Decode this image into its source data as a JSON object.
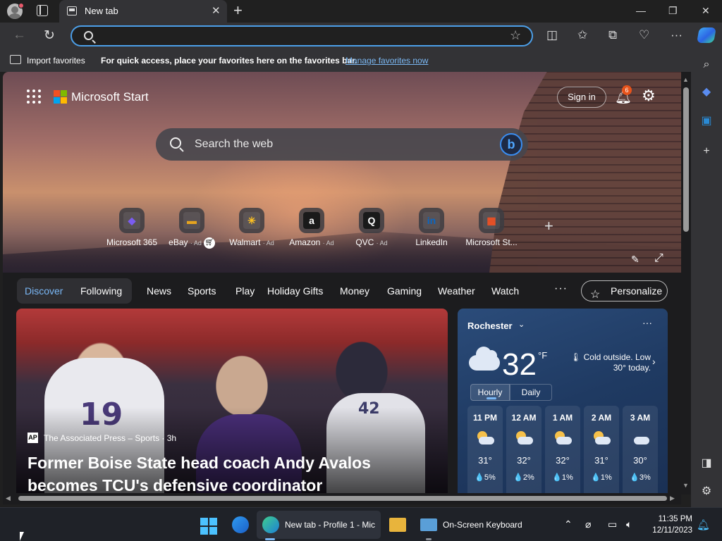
{
  "browser": {
    "tab_title": "New tab",
    "tab_close": "✕",
    "new_tab": "+",
    "win_minimize": "—",
    "win_restore": "❐",
    "win_close": "✕",
    "address_value": "",
    "address_placeholder": "",
    "favorites_bar": {
      "import_label": "Import favorites",
      "hint": "For quick access, place your favorites here on the favorites bar.",
      "manage_link": "Manage favorites now"
    }
  },
  "page": {
    "brand": "Microsoft Start",
    "sign_in": "Sign in",
    "notifications_count": "6",
    "search_placeholder": "Search the web",
    "bing_glyph": "b",
    "quick_links": [
      {
        "label": "Microsoft 365",
        "ad": "",
        "glyph": "◆",
        "color": "#7a5cf0"
      },
      {
        "label": "eBay",
        "ad": "· Ad",
        "glyph": "▬",
        "color": "#e5a41f"
      },
      {
        "label": "Walmart",
        "ad": "· Ad",
        "glyph": "✳",
        "color": "#ffc220"
      },
      {
        "label": "Amazon",
        "ad": "· Ad",
        "glyph": "a",
        "color": "#ffffff"
      },
      {
        "label": "QVC",
        "ad": "· Ad",
        "glyph": "Q",
        "color": "#ffffff"
      },
      {
        "label": "LinkedIn",
        "ad": "",
        "glyph": "in",
        "color": "#0a66c2"
      },
      {
        "label": "Microsoft St...",
        "ad": "",
        "glyph": "▦",
        "color": "#f25022"
      }
    ],
    "nav": {
      "tabs": [
        "Discover",
        "Following",
        "News",
        "Sports",
        "Play",
        "Holiday Gifts",
        "Money",
        "Gaming",
        "Weather",
        "Watch"
      ],
      "more": "···",
      "personalize": "Personalize"
    },
    "article": {
      "source_logo": "AP",
      "source": "The Associated Press – Sports · 3h",
      "title": "Former Boise State head coach Andy Avalos becomes TCU's defensive coordinator",
      "jersey_a": "19",
      "jersey_b": "42"
    },
    "weather": {
      "city": "Rochester",
      "chevron": "⌄",
      "more": "···",
      "temp": "32",
      "unit": "°F",
      "condition": "🌡 Cold outside. Low 30° today.",
      "arrow": "›",
      "tabs": [
        "Hourly",
        "Daily"
      ],
      "hours": [
        {
          "time": "11 PM",
          "temp": "31°",
          "precip": "💧5%",
          "sun": true
        },
        {
          "time": "12 AM",
          "temp": "32°",
          "precip": "💧2%",
          "sun": true
        },
        {
          "time": "1 AM",
          "temp": "32°",
          "precip": "💧1%",
          "sun": true
        },
        {
          "time": "2 AM",
          "temp": "31°",
          "precip": "💧1%",
          "sun": true
        },
        {
          "time": "3 AM",
          "temp": "30°",
          "precip": "💧3%",
          "sun": false
        }
      ]
    }
  },
  "taskbar": {
    "edge_window": "New tab - Profile 1 - Mic",
    "osk_window": "On-Screen Keyboard",
    "time": "11:35 PM",
    "date": "12/11/2023",
    "colors": {
      "accent": "#4cc2ff",
      "edge_accent": "#7ab7f5"
    }
  }
}
